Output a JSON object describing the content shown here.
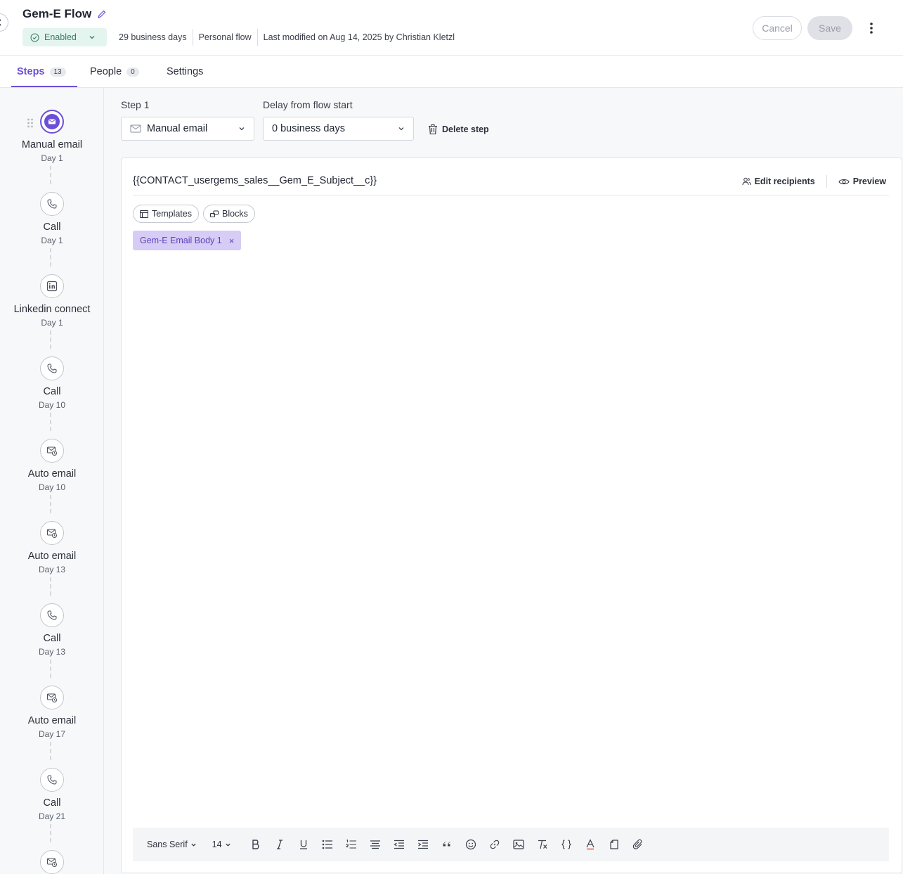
{
  "header": {
    "title": "Gem-E Flow",
    "status": "Enabled",
    "meta": [
      "29 business days",
      "Personal flow",
      "Last modified on Aug 14, 2025 by Christian Kletzl"
    ],
    "cancel_label": "Cancel",
    "save_label": "Save"
  },
  "tabs": [
    {
      "label": "Steps",
      "count": "13"
    },
    {
      "label": "People",
      "count": "0"
    },
    {
      "label": "Settings"
    }
  ],
  "steps": [
    {
      "name": "Manual email",
      "day": "Day 1",
      "icon": "mail-icon"
    },
    {
      "name": "Call",
      "day": "Day 1",
      "icon": "phone-icon"
    },
    {
      "name": "Linkedin connect",
      "day": "Day 1",
      "icon": "linkedin-icon"
    },
    {
      "name": "Call",
      "day": "Day 10",
      "icon": "phone-icon"
    },
    {
      "name": "Auto email",
      "day": "Day 10",
      "icon": "auto-email-icon"
    },
    {
      "name": "Auto email",
      "day": "Day 13",
      "icon": "auto-email-icon"
    },
    {
      "name": "Call",
      "day": "Day 13",
      "icon": "phone-icon"
    },
    {
      "name": "Auto email",
      "day": "Day 17",
      "icon": "auto-email-icon"
    },
    {
      "name": "Call",
      "day": "Day 21",
      "icon": "phone-icon"
    }
  ],
  "step_form": {
    "step_label": "Step 1",
    "step_type": "Manual email",
    "delay_label": "Delay from flow start",
    "delay_value": "0 business days",
    "delete_label": "Delete step"
  },
  "editor": {
    "subject": "{{CONTACT_usergems_sales__Gem_E_Subject__c}}",
    "edit_recipients_label": "Edit recipients",
    "preview_label": "Preview",
    "templates_label": "Templates",
    "blocks_label": "Blocks",
    "block_tag": "Gem-E Email Body 1",
    "toolbar": {
      "font_family": "Sans Serif",
      "font_size": "14"
    }
  },
  "colors": {
    "accent": "#6c4fd6",
    "enabled_bg": "#e3f5ee",
    "enabled_text": "#3c7a62",
    "block_tag_bg": "#d7ccf5"
  }
}
